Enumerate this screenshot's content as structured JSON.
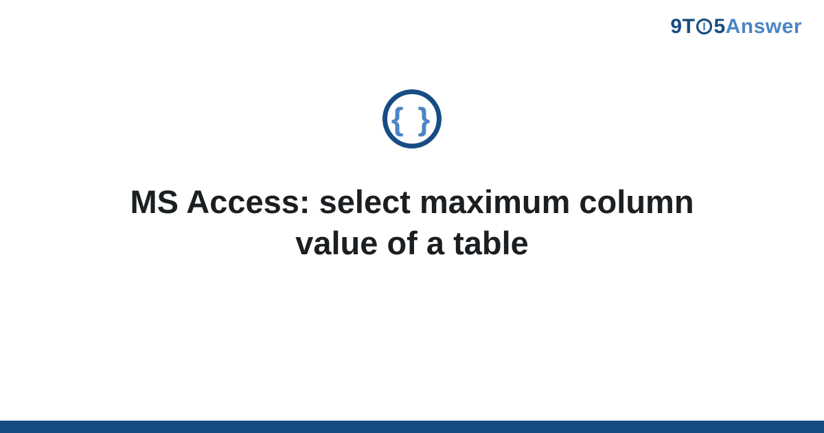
{
  "brand": {
    "part_nine": "9",
    "part_t": "T",
    "part_five": "5",
    "part_answer": "Answer"
  },
  "icon": {
    "glyph": "{ }",
    "name": "code-braces-icon"
  },
  "title": "MS Access: select maximum column value of a table",
  "colors": {
    "primary": "#174c84",
    "accent": "#4b85c5",
    "text": "#1b1f22"
  }
}
